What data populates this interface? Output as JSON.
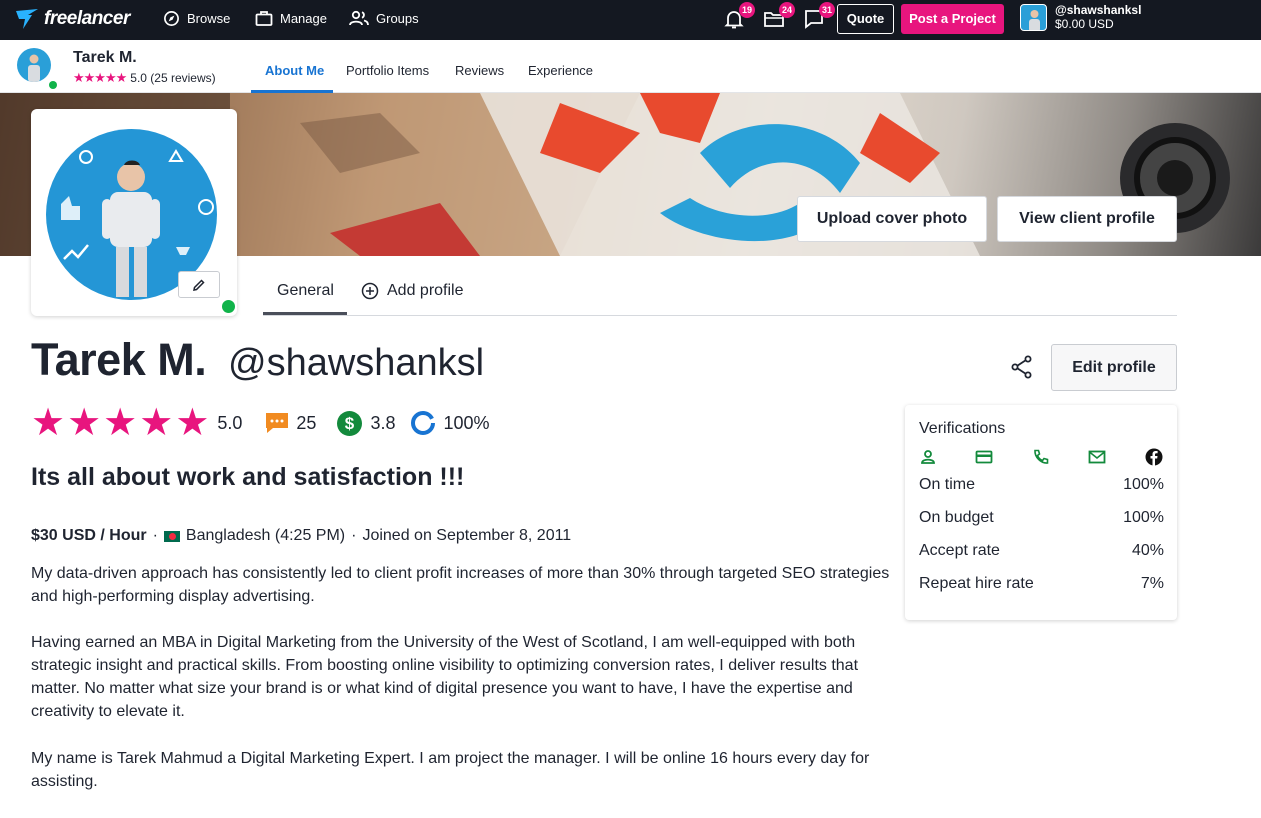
{
  "topnav": {
    "brand": "freelancer",
    "browse": "Browse",
    "manage": "Manage",
    "groups": "Groups",
    "notifications_count": "19",
    "projects_count": "24",
    "messages_count": "31",
    "quote": "Quote",
    "post_project": "Post a Project",
    "username": "@shawshanksl",
    "balance": "$0.00 USD"
  },
  "subheader": {
    "name": "Tarek M.",
    "stars": "★★★★★",
    "rating": "5.0 (25 reviews)",
    "tabs": [
      "About Me",
      "Portfolio Items",
      "Reviews",
      "Experience"
    ]
  },
  "cover": {
    "upload": "Upload cover photo",
    "view_client": "View client profile"
  },
  "profile_tabs": {
    "general": "General",
    "add_profile": "Add profile"
  },
  "profile": {
    "name": "Tarek M.",
    "handle": "@shawshanksl",
    "edit": "Edit profile",
    "rating": "5.0",
    "reviews": "25",
    "earnings_score": "3.8",
    "completion": "100%",
    "tagline": "Its all about work and satisfaction !!!",
    "rate": "$30 USD / Hour",
    "location": "Bangladesh (4:25 PM)",
    "joined": "Joined on September 8, 2011",
    "bio": [
      "My data-driven approach has consistently led to client profit increases of more than 30% through targeted SEO strategies and high-performing display advertising.",
      "Having earned an MBA in Digital Marketing from the University of the West of Scotland, I am well-equipped with both strategic insight and practical skills. From boosting online visibility to optimizing conversion rates, I deliver results that matter. No matter what size your brand is or what kind of digital presence you want to have, I have the expertise and creativity to elevate it.",
      "My name is Tarek Mahmud a Digital Marketing Expert. I am project the manager. I will be online 16 hours every day for assisting."
    ]
  },
  "verifications": {
    "title": "Verifications",
    "icons": [
      "user-icon",
      "credit-card-icon",
      "phone-icon",
      "email-icon",
      "facebook-icon"
    ],
    "rows": [
      {
        "label": "On time",
        "value": "100%"
      },
      {
        "label": "On budget",
        "value": "100%"
      },
      {
        "label": "Accept rate",
        "value": "40%"
      },
      {
        "label": "Repeat hire rate",
        "value": "7%"
      }
    ]
  },
  "colors": {
    "accent_pink": "#e8157e",
    "accent_blue": "#1874d2",
    "verified_green": "#10b34a",
    "nav_bg": "#141821"
  }
}
